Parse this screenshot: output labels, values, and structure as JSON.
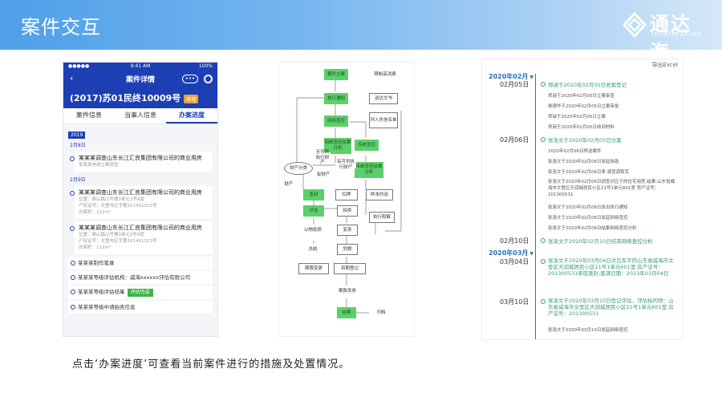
{
  "header": {
    "title": "案件交互"
  },
  "logo": {
    "name": "通达海",
    "sub": "Information"
  },
  "phone": {
    "status_time": "9:41 AM",
    "status_left": "●●●●●",
    "status_right": "100%",
    "nav_title": "案件详情",
    "nav_back": "‹",
    "nav_menu": "•••",
    "case_no": "(2017)苏01民终10009号",
    "case_badge": "审理",
    "tabs": [
      "案件信息",
      "当事人信息",
      "办案进度"
    ],
    "year": "2019",
    "date1": "2月8日",
    "card1": {
      "main": "某某某调查山东长江汇良集团有限公司的商业用房",
      "sub": "某某某申请立案调查"
    },
    "date2": "2月9日",
    "card2": {
      "main": "某某某调查山东长江汇良集团有限公司的商业用房",
      "l1": "位置：奥山路/2号楼3单元3号4层",
      "l2": "产权证号：文登市区字第201401023号",
      "l3": "总面积：112m²"
    },
    "card3": {
      "main": "某某某调查山东长江汇良集团有限公司的商业用房",
      "l1": "位置：奥山路/2号楼3单元3号4层",
      "l2": "产权证号：文登市区字第201401023号",
      "l3": "总面积：112m²"
    },
    "row1": "某某某制作笔录",
    "row2": "某某某等级评估机构：威海xxxxxx评估有限公司",
    "row3_text": "某某某等级评估结果",
    "row3_badge": "评估完成",
    "row4": "某某某等级中请拍卖信息"
  },
  "flow": {
    "n_start": "案件立案",
    "n_assign": "执行通知",
    "n_query": "网络查控",
    "n_result1": "网络查控结果分析",
    "n_trad": "传统查控",
    "n_result2": "传统查控结果分析",
    "n_prop": "财产分类",
    "n_seize": "查封",
    "n_eval": "评估",
    "n_auction": "拍卖",
    "n_sell": "变卖",
    "n_goods": "以物抵债",
    "n_end": "冻结",
    "n_transfer": "划拨",
    "n_period": "期限变更",
    "n_reg": "到期登记",
    "n_settle": "案款发放",
    "n_close": "结案",
    "n_archive": "归档",
    "n_pd1": "限制高消费",
    "n_pd2": "送达文书",
    "n_pd3": "列入失信名单",
    "n_pd4": "终本约谈",
    "n_pd5": "执行和解",
    "n_pd6": "扣押",
    "lbl1": "有财产",
    "lbl2": "财产",
    "lbl3": "无可供执行财产",
    "lbl4": "有可供执行财产"
  },
  "timeline": {
    "export": "导出Excel",
    "m1": "2020年02月",
    "m2": "2020年03月",
    "days": [
      "02月05日",
      "02月06日",
      "02月10日",
      "03月04日",
      "03月10日"
    ],
    "e1": "郑淑于2020年02月05日收案登记",
    "e1a": "郑淑于2020年02月05日立案审查",
    "e1b": "侯德华于2020年02月05日立案审批",
    "e1c": "郑淑于2020年02月05日立案",
    "e1d": "郑淑于2020年02月05日收到材料",
    "e2": "张洛文于2020年02月05日分案",
    "e2a": "2020年02月06日移送案件",
    "e2b": "张洛文于2020年02月06日发起协助",
    "e2c": "张洛文于2020年02月06日表 调查调取军",
    "e2d": "张洛文于2020年02月06日调查对应于的住宅用房,结果:山东省威海市文登区天润城居民小区21号1单元601室 房产证号：201300531",
    "e2e": "张洛文于2020年02月06日发出执行通知",
    "e2f": "张洛文于2020年02月06日发起网络查控",
    "e2g": "张洛文于2020年02月06日结果网络查控分析",
    "e3": "张洛文于2020年02月10日结束网络查控分析",
    "e4": "张洛文于2020年03月04日对吕军平的山东省威海市文登区天润城居民小区21号1单元601室 房产证号：201300531来取查封,届满日期：2023年03月04日",
    "e5": "张洛文于2020年03月10日登记评估，评估标的物：山东省威海市文登区天润城居民小区21号1单元601室 房产证号：201300531",
    "e5a": "张洛文于2020年03月10日发起网络查控"
  },
  "caption": "点击‘办案进度’可查看当前案件进行的措施及处置情况。",
  "colors": {
    "header": "#4f9fe8",
    "phone_nav": "#1d3fb4",
    "flow_green": "#5cd06a",
    "timeline_blue": "#2c6fb7",
    "timeline_green": "#3b9b73"
  }
}
